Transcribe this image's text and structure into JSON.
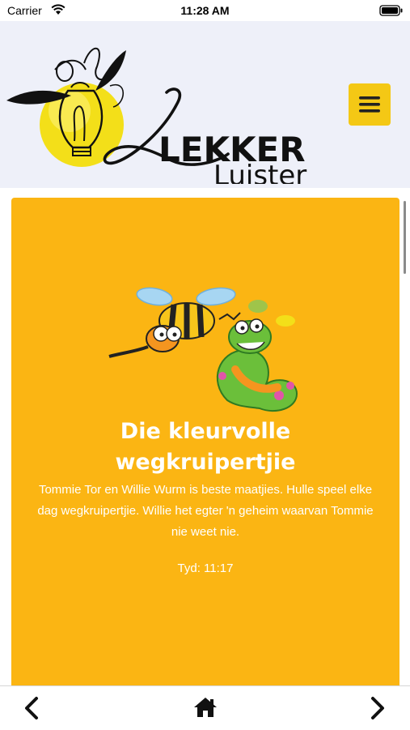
{
  "status_bar": {
    "carrier": "Carrier",
    "time": "11:28 AM"
  },
  "header": {
    "logo_line1": "LEKKER",
    "logo_line2": "Luister",
    "menu_icon": "hamburger-icon",
    "menu_color": "#f4c815"
  },
  "story": {
    "title_line1": "Die kleurvolle",
    "title_line2": "wegkruipertjie",
    "description": "Tommie Tor en Willie Wurm is beste maatjies. Hulle speel elke dag wegkruipertjie. Willie het egter 'n geheim waarvan Tommie nie weet nie.",
    "duration": "Tyd: 11:17",
    "card_color": "#fbb513"
  },
  "bottom_nav": {
    "back_icon": "chevron-left-icon",
    "home_icon": "home-icon",
    "forward_icon": "chevron-right-icon"
  }
}
